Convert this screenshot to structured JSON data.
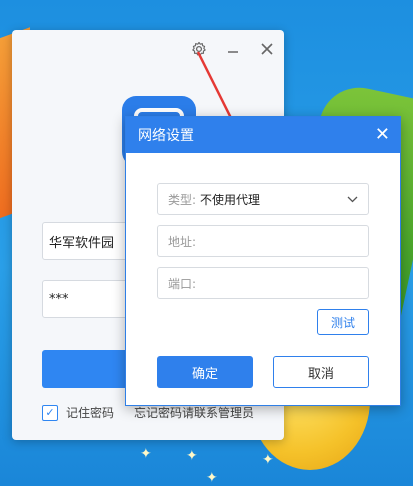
{
  "login": {
    "username_value": "华军软件园",
    "password_value": "***",
    "remember_label": "记住密码",
    "remember_checked": true,
    "forgot_label": "忘记密码请联系管理员"
  },
  "network_dialog": {
    "title": "网络设置",
    "type_label": "类型:",
    "type_value": "不使用代理",
    "address_placeholder": "地址:",
    "port_placeholder": "端口:",
    "test_label": "测试",
    "ok_label": "确定",
    "cancel_label": "取消"
  },
  "icons": {
    "settings": "gear-icon",
    "minimize": "minimize-icon",
    "close": "close-icon",
    "dropdown": "chevron-down-icon"
  },
  "colors": {
    "accent": "#2f80ec",
    "arrow": "#e53935"
  }
}
